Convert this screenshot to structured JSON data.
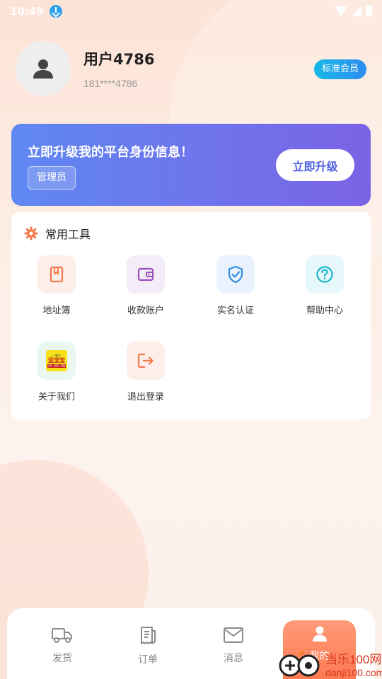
{
  "status_bar": {
    "time": "10:49"
  },
  "profile": {
    "name": "用户4786",
    "phone": "181****4786",
    "member_badge": "标准会员"
  },
  "banner": {
    "title": "立即升级我的平台身份信息！",
    "role": "管理员",
    "button": "立即升级"
  },
  "tools": {
    "title": "常用工具",
    "items": [
      {
        "label": "地址簿",
        "icon": "address-book-icon",
        "bg": "#fdeeea"
      },
      {
        "label": "收款账户",
        "icon": "wallet-icon",
        "bg": "#f4ecf7"
      },
      {
        "label": "实名认证",
        "icon": "shield-check-icon",
        "bg": "#eaf3fd"
      },
      {
        "label": "帮助中心",
        "icon": "help-icon",
        "bg": "#e6f8fb"
      },
      {
        "label": "关于我们",
        "icon": "about-logo-icon",
        "bg": "#eaf7ef"
      },
      {
        "label": "退出登录",
        "icon": "logout-icon",
        "bg": "#fdeeea"
      }
    ]
  },
  "about_logo_text": {
    "top": "一路全",
    "main": "运宝宝",
    "bottom": "货运 · 搬家 · 跑腿"
  },
  "bottom_nav": {
    "items": [
      {
        "label": "发货",
        "icon": "truck-icon"
      },
      {
        "label": "订单",
        "icon": "receipt-icon"
      },
      {
        "label": "消息",
        "icon": "mail-icon"
      },
      {
        "label": "我的",
        "icon": "user-icon"
      }
    ]
  },
  "watermark": {
    "title": "当乐100网",
    "url": "danji100.com"
  },
  "colors": {
    "accent": "#fd7a52",
    "banner_start": "#5f88f2",
    "banner_end": "#7b63e6",
    "badge": "#2d8ef0"
  }
}
